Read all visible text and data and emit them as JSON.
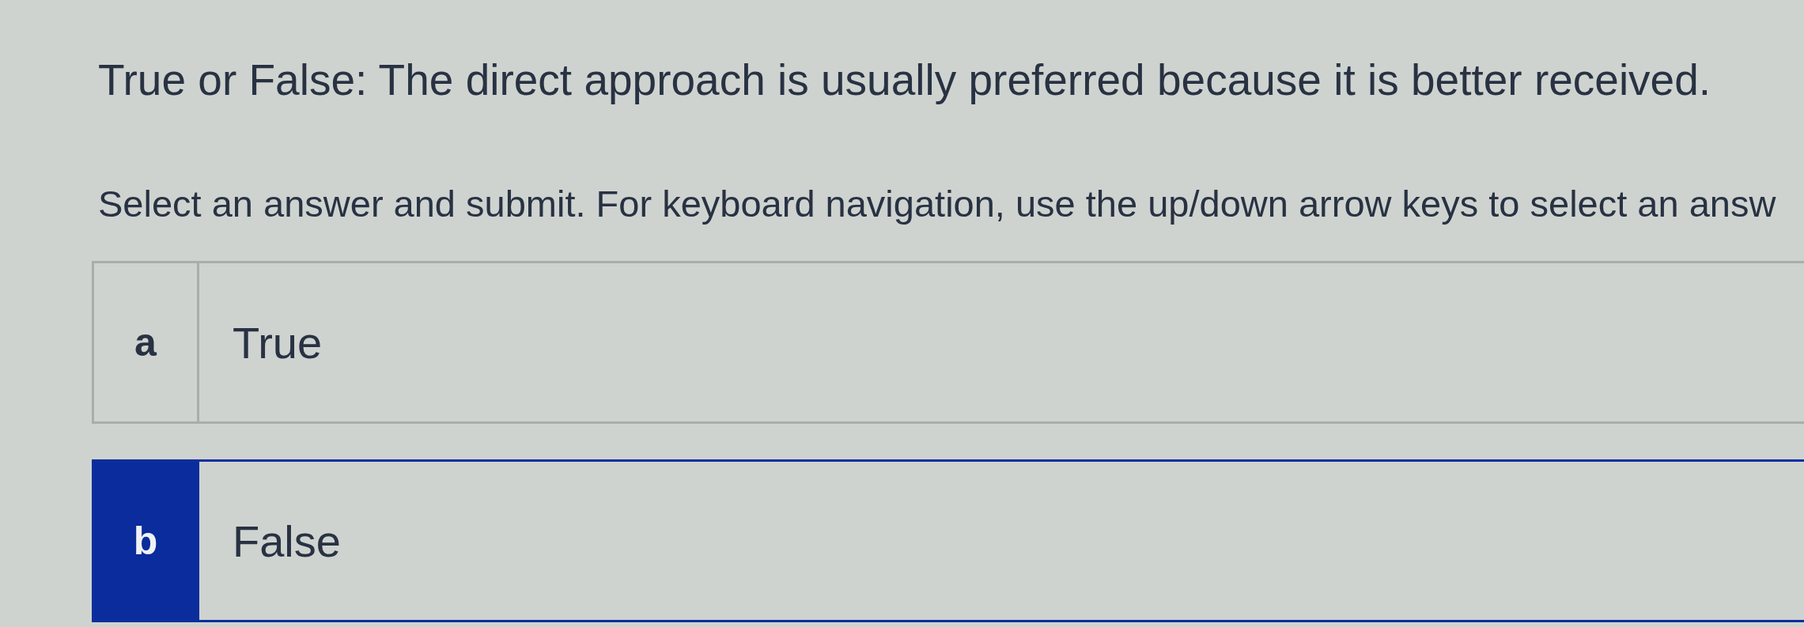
{
  "question": "True or False: The direct approach is usually preferred because it is better received.",
  "instructions": "Select an answer and submit. For keyboard navigation, use the up/down arrow keys to select an answ",
  "options": [
    {
      "letter": "a",
      "label": "True",
      "selected": false
    },
    {
      "letter": "b",
      "label": "False",
      "selected": true
    }
  ]
}
